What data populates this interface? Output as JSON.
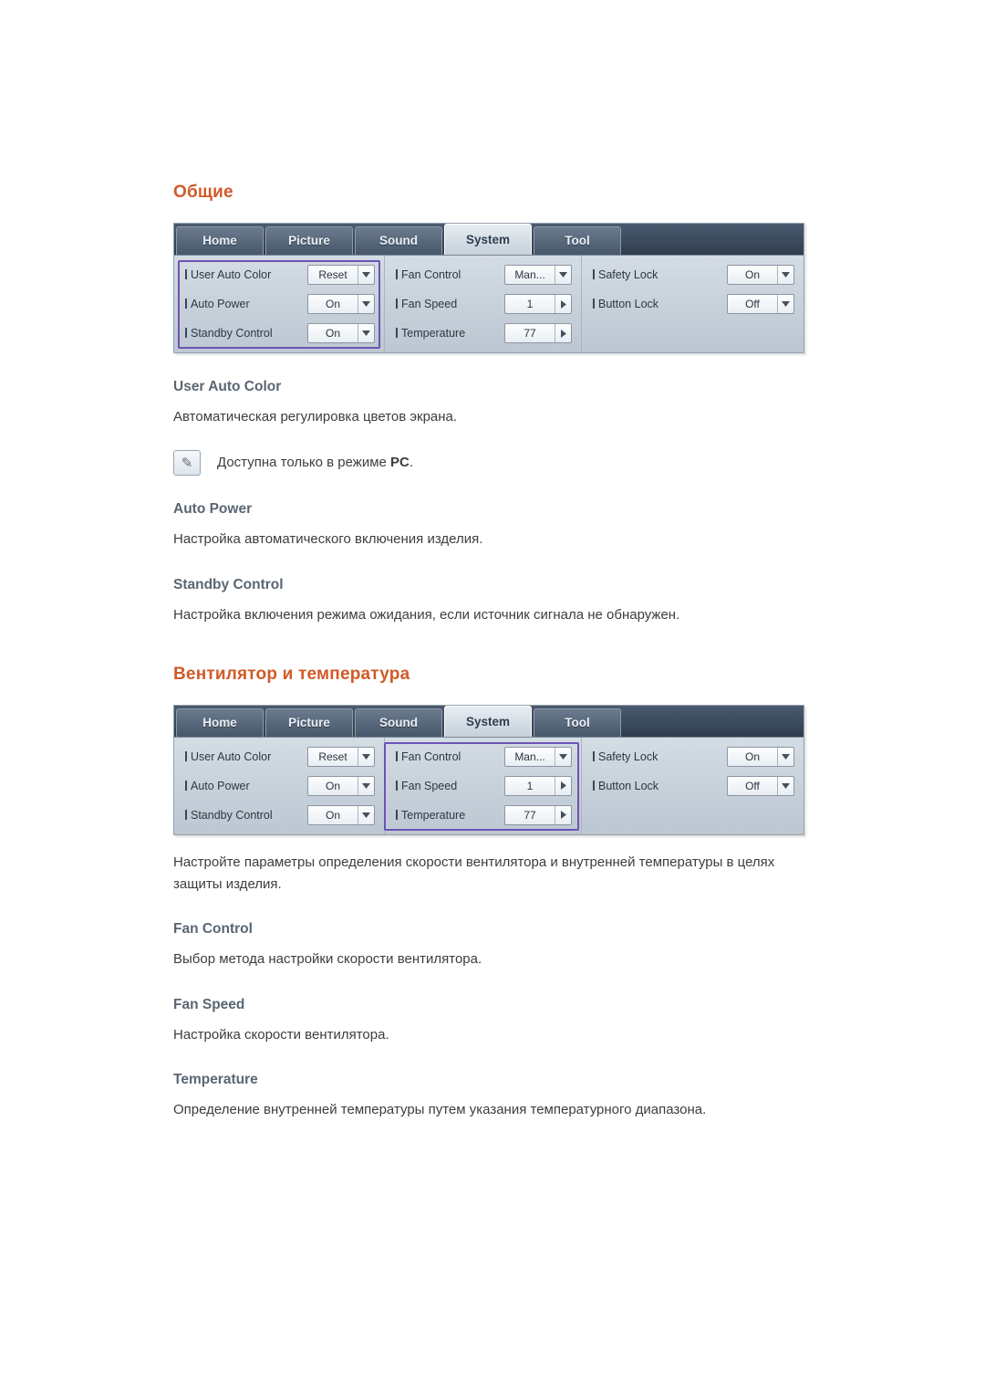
{
  "sections": [
    {
      "title": "Общие",
      "figure": {
        "tabs": [
          "Home",
          "Picture",
          "Sound",
          "System",
          "Tool"
        ],
        "active_tab": "System",
        "columns": [
          {
            "rows": [
              {
                "label": "User Auto Color",
                "value": "Reset",
                "control": "dropdown"
              },
              {
                "label": "Auto Power",
                "value": "On",
                "control": "dropdown"
              },
              {
                "label": "Standby Control",
                "value": "On",
                "control": "dropdown"
              }
            ]
          },
          {
            "rows": [
              {
                "label": "Fan Control",
                "value": "Man...",
                "control": "dropdown"
              },
              {
                "label": "Fan Speed",
                "value": "1",
                "control": "stepper"
              },
              {
                "label": "Temperature",
                "value": "77",
                "control": "stepper"
              }
            ]
          },
          {
            "rows": [
              {
                "label": "Safety Lock",
                "value": "On",
                "control": "dropdown"
              },
              {
                "label": "Button Lock",
                "value": "Off",
                "control": "dropdown"
              }
            ]
          }
        ],
        "highlight": "left-column"
      },
      "items": [
        {
          "heading": "User Auto Color",
          "text": "Автоматическая регулировка цветов экрана.",
          "note": {
            "icon": "note-pencil-icon",
            "text_before": "Доступна только в режиме ",
            "bold": "PC",
            "text_after": "."
          }
        },
        {
          "heading": "Auto Power",
          "text": "Настройка автоматического включения изделия."
        },
        {
          "heading": "Standby Control",
          "text": "Настройка включения режима ожидания, если источник сигнала не обнаружен."
        }
      ]
    },
    {
      "title": "Вентилятор и температура",
      "figure": {
        "tabs": [
          "Home",
          "Picture",
          "Sound",
          "System",
          "Tool"
        ],
        "active_tab": "System",
        "columns": [
          {
            "rows": [
              {
                "label": "User Auto Color",
                "value": "Reset",
                "control": "dropdown"
              },
              {
                "label": "Auto Power",
                "value": "On",
                "control": "dropdown"
              },
              {
                "label": "Standby Control",
                "value": "On",
                "control": "dropdown"
              }
            ]
          },
          {
            "rows": [
              {
                "label": "Fan Control",
                "value": "Man...",
                "control": "dropdown"
              },
              {
                "label": "Fan Speed",
                "value": "1",
                "control": "stepper"
              },
              {
                "label": "Temperature",
                "value": "77",
                "control": "stepper"
              }
            ]
          },
          {
            "rows": [
              {
                "label": "Safety Lock",
                "value": "On",
                "control": "dropdown"
              },
              {
                "label": "Button Lock",
                "value": "Off",
                "control": "dropdown"
              }
            ]
          }
        ],
        "highlight": "middle-column"
      },
      "intro": "Настройте параметры определения скорости вентилятора и внутренней температуры в целях защиты изделия.",
      "items": [
        {
          "heading": "Fan Control",
          "text": "Выбор метода настройки скорости вентилятора."
        },
        {
          "heading": "Fan Speed",
          "text": "Настройка скорости вентилятора."
        },
        {
          "heading": "Temperature",
          "text": "Определение внутренней температуры путем указания температурного диапазона."
        }
      ]
    }
  ],
  "colors": {
    "accent": "#d15a28",
    "subheading": "#5a6672",
    "highlight": "#6b54b4",
    "body": "#3d3d3d"
  }
}
